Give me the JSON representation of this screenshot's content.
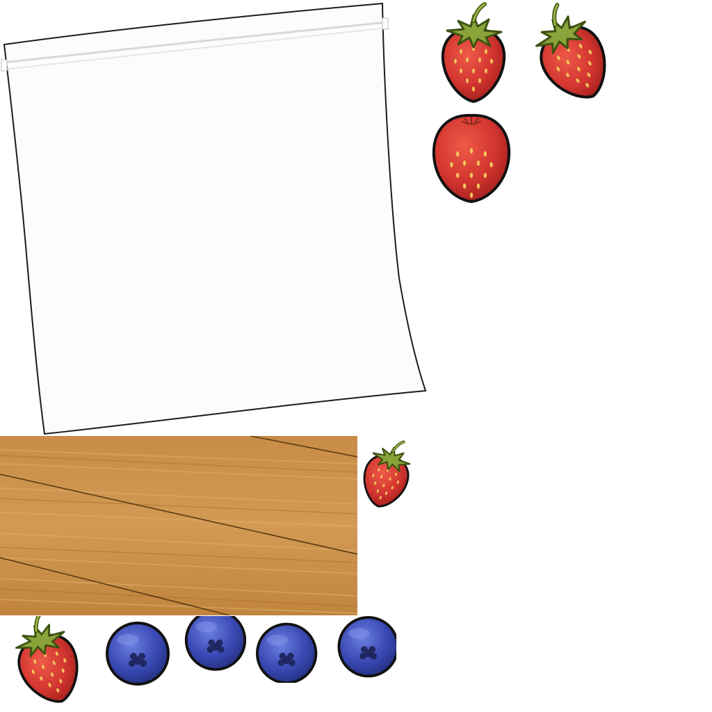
{
  "scene": {
    "background": "#ffffff",
    "bag": {
      "kind": "zip-bag",
      "fill": "#fcfcfc",
      "stroke": "#1b1b1b",
      "zipper": "#d8d8d8"
    },
    "board": {
      "kind": "wood-cutting-board",
      "base": "#c48945",
      "light": "#d9a35e",
      "dark": "#a06a2c",
      "line": "#6b4419"
    },
    "strawberry_colors": {
      "body": "#d63a33",
      "shade": "#a5201c",
      "seed": "#f3c25b",
      "leaf": "#8aa33a",
      "leaf_dark": "#5f7a22",
      "outline": "#111111"
    },
    "blueberry_colors": {
      "body": "#3a49b0",
      "light": "#5c6fd0",
      "dark": "#1f2a78",
      "blossom": "#1c2257",
      "outline": "#111111"
    },
    "pieces": {
      "strawberries": [
        "strawberry-1",
        "strawberry-2",
        "strawberry-3",
        "strawberry-4",
        "strawberry-5"
      ],
      "blueberries": [
        "blueberry-1",
        "blueberry-2",
        "blueberry-3",
        "blueberry-4"
      ]
    }
  }
}
